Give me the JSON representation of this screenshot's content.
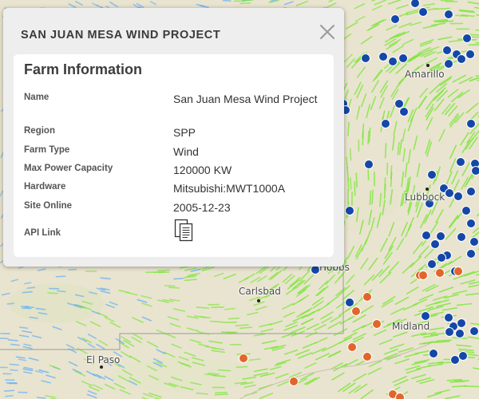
{
  "map": {
    "cities": [
      {
        "name": "Amarillo"
      },
      {
        "name": "Lubbock"
      },
      {
        "name": "Hobbs"
      },
      {
        "name": "Carlsbad"
      },
      {
        "name": "Midland"
      },
      {
        "name": "El Paso"
      }
    ],
    "colors": {
      "wind_site": "#1447a8",
      "other_site": "#e2652c",
      "flow_strong": "#7de63a",
      "flow_weak": "#4aa6ff"
    }
  },
  "popup": {
    "title": "SAN JUAN MESA WIND PROJECT",
    "close_icon": "close-icon",
    "section_title": "Farm Information",
    "fields": [
      {
        "label": "Name",
        "value": "San Juan Mesa Wind Project"
      },
      {
        "label": "Region",
        "value": "SPP"
      },
      {
        "label": "Farm Type",
        "value": "Wind"
      },
      {
        "label": "Max Power Capacity",
        "value": "120000 KW"
      },
      {
        "label": "Hardware",
        "value": "Mitsubishi:MWT1000A"
      },
      {
        "label": "Site Online",
        "value": "2005-12-23"
      }
    ],
    "api_link": {
      "label": "API Link",
      "icon": "documents-icon"
    }
  }
}
